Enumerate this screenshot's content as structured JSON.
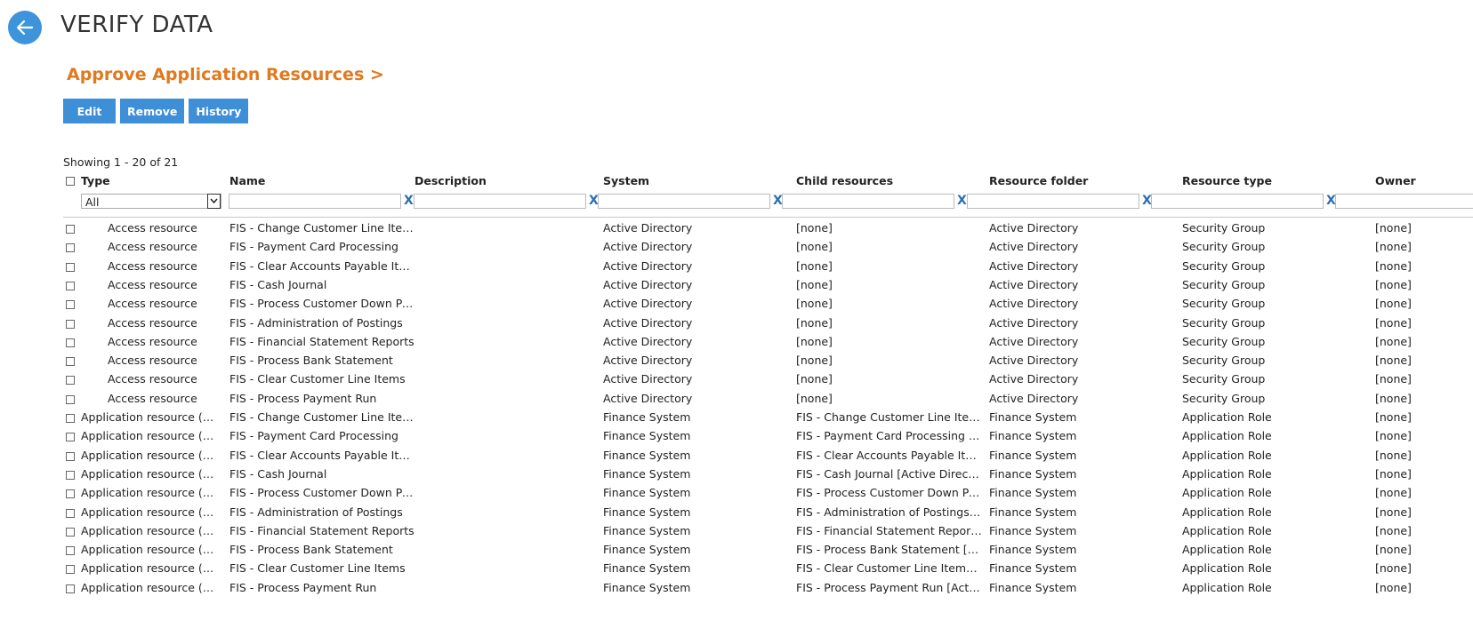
{
  "header": {
    "back_icon": "arrow-left-icon",
    "title": "VERIFY DATA"
  },
  "section": {
    "heading": "Approve Application Resources >"
  },
  "toolbar": {
    "edit_label": "Edit",
    "remove_label": "Remove",
    "history_label": "History"
  },
  "table": {
    "showing_text": "Showing 1 - 20 of 21",
    "columns": {
      "type": "Type",
      "name": "Name",
      "description": "Description",
      "system": "System",
      "child_resources": "Child resources",
      "resource_folder": "Resource folder",
      "resource_type": "Resource type",
      "owner": "Owner"
    },
    "filters": {
      "type_selected": "All",
      "clear_label": "X"
    },
    "rows": [
      {
        "type": "Access resource",
        "name": "FIS - Change Customer Line Items",
        "description": "",
        "system": "Active Directory",
        "child": "[none]",
        "folder": "Active Directory",
        "rtype": "Security Group",
        "owner": "[none]"
      },
      {
        "type": "Access resource",
        "name": "FIS - Payment Card Processing",
        "description": "",
        "system": "Active Directory",
        "child": "[none]",
        "folder": "Active Directory",
        "rtype": "Security Group",
        "owner": "[none]"
      },
      {
        "type": "Access resource",
        "name": "FIS - Clear Accounts Payable Items",
        "description": "",
        "system": "Active Directory",
        "child": "[none]",
        "folder": "Active Directory",
        "rtype": "Security Group",
        "owner": "[none]"
      },
      {
        "type": "Access resource",
        "name": "FIS - Cash Journal",
        "description": "",
        "system": "Active Directory",
        "child": "[none]",
        "folder": "Active Directory",
        "rtype": "Security Group",
        "owner": "[none]"
      },
      {
        "type": "Access resource",
        "name": "FIS - Process Customer Down Pay...",
        "description": "",
        "system": "Active Directory",
        "child": "[none]",
        "folder": "Active Directory",
        "rtype": "Security Group",
        "owner": "[none]"
      },
      {
        "type": "Access resource",
        "name": "FIS - Administration of Postings",
        "description": "",
        "system": "Active Directory",
        "child": "[none]",
        "folder": "Active Directory",
        "rtype": "Security Group",
        "owner": "[none]"
      },
      {
        "type": "Access resource",
        "name": "FIS - Financial Statement Reports",
        "description": "",
        "system": "Active Directory",
        "child": "[none]",
        "folder": "Active Directory",
        "rtype": "Security Group",
        "owner": "[none]"
      },
      {
        "type": "Access resource",
        "name": "FIS - Process Bank Statement",
        "description": "",
        "system": "Active Directory",
        "child": "[none]",
        "folder": "Active Directory",
        "rtype": "Security Group",
        "owner": "[none]"
      },
      {
        "type": "Access resource",
        "name": "FIS - Clear Customer Line Items",
        "description": "",
        "system": "Active Directory",
        "child": "[none]",
        "folder": "Active Directory",
        "rtype": "Security Group",
        "owner": "[none]"
      },
      {
        "type": "Access resource",
        "name": "FIS - Process Payment Run",
        "description": "",
        "system": "Active Directory",
        "child": "[none]",
        "folder": "Active Directory",
        "rtype": "Security Group",
        "owner": "[none]"
      },
      {
        "type": "Application resource (ne...",
        "name": "FIS - Change Customer Line Items",
        "description": "",
        "system": "Finance System",
        "child": "FIS - Change Customer Line Items...",
        "folder": "Finance System",
        "rtype": "Application Role",
        "owner": "[none]"
      },
      {
        "type": "Application resource (ne...",
        "name": "FIS - Payment Card Processing",
        "description": "",
        "system": "Finance System",
        "child": "FIS - Payment Card Processing [Ac...",
        "folder": "Finance System",
        "rtype": "Application Role",
        "owner": "[none]"
      },
      {
        "type": "Application resource (ne...",
        "name": "FIS - Clear Accounts Payable Items",
        "description": "",
        "system": "Finance System",
        "child": "FIS - Clear Accounts Payable Item...",
        "folder": "Finance System",
        "rtype": "Application Role",
        "owner": "[none]"
      },
      {
        "type": "Application resource (ne...",
        "name": "FIS - Cash Journal",
        "description": "",
        "system": "Finance System",
        "child": "FIS - Cash Journal [Active Directory]",
        "folder": "Finance System",
        "rtype": "Application Role",
        "owner": "[none]"
      },
      {
        "type": "Application resource (ne...",
        "name": "FIS - Process Customer Down Pay...",
        "description": "",
        "system": "Finance System",
        "child": "FIS - Process Customer Down Pay...",
        "folder": "Finance System",
        "rtype": "Application Role",
        "owner": "[none]"
      },
      {
        "type": "Application resource (ne...",
        "name": "FIS - Administration of Postings",
        "description": "",
        "system": "Finance System",
        "child": "FIS - Administration of Postings [A...",
        "folder": "Finance System",
        "rtype": "Application Role",
        "owner": "[none]"
      },
      {
        "type": "Application resource (ne...",
        "name": "FIS - Financial Statement Reports",
        "description": "",
        "system": "Finance System",
        "child": "FIS - Financial Statement Reports...",
        "folder": "Finance System",
        "rtype": "Application Role",
        "owner": "[none]"
      },
      {
        "type": "Application resource (ne...",
        "name": "FIS - Process Bank Statement",
        "description": "",
        "system": "Finance System",
        "child": "FIS - Process Bank Statement [Acti...",
        "folder": "Finance System",
        "rtype": "Application Role",
        "owner": "[none]"
      },
      {
        "type": "Application resource (ne...",
        "name": "FIS - Clear Customer Line Items",
        "description": "",
        "system": "Finance System",
        "child": "FIS - Clear Customer Line Items [A...",
        "folder": "Finance System",
        "rtype": "Application Role",
        "owner": "[none]"
      },
      {
        "type": "Application resource (ne...",
        "name": "FIS - Process Payment Run",
        "description": "",
        "system": "Finance System",
        "child": "FIS - Process Payment Run [Active...",
        "folder": "Finance System",
        "rtype": "Application Role",
        "owner": "[none]"
      }
    ]
  },
  "colors": {
    "accent_blue": "#3d8fd8",
    "heading_orange": "#e07a1f",
    "clear_x_blue": "#2a6fb5"
  }
}
